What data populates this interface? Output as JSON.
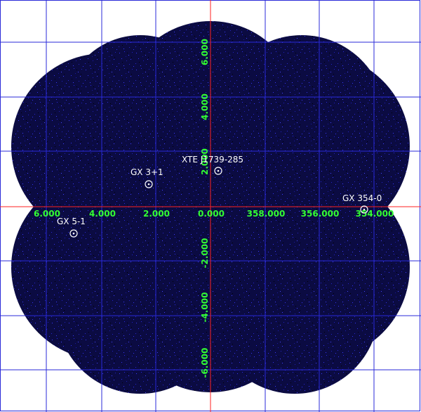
{
  "image": {
    "projection": "galactic",
    "background_color": "#ffffff",
    "field_color": "#0a0a40",
    "grid_color": "#2a2ad8",
    "axis_color": "#ff2020",
    "tick_label_color": "#33ff33",
    "source_label_color": "#ffffff"
  },
  "longitude_labels": [
    "6.000",
    "4.000",
    "2.000",
    "0.000",
    "358.000",
    "356.000",
    "354.000"
  ],
  "latitude_labels": [
    "6.000",
    "4.000",
    "2.000",
    "-2.000",
    "-4.000",
    "-6.000"
  ],
  "sources": [
    {
      "name": "XTE J1739-285",
      "marker": "circle-dot-icon"
    },
    {
      "name": "GX 3+1",
      "marker": "circle-dot-icon"
    },
    {
      "name": "GX 354-0",
      "marker": "circle-dot-icon"
    },
    {
      "name": "GX 5-1",
      "marker": "circle-dot-icon"
    }
  ]
}
